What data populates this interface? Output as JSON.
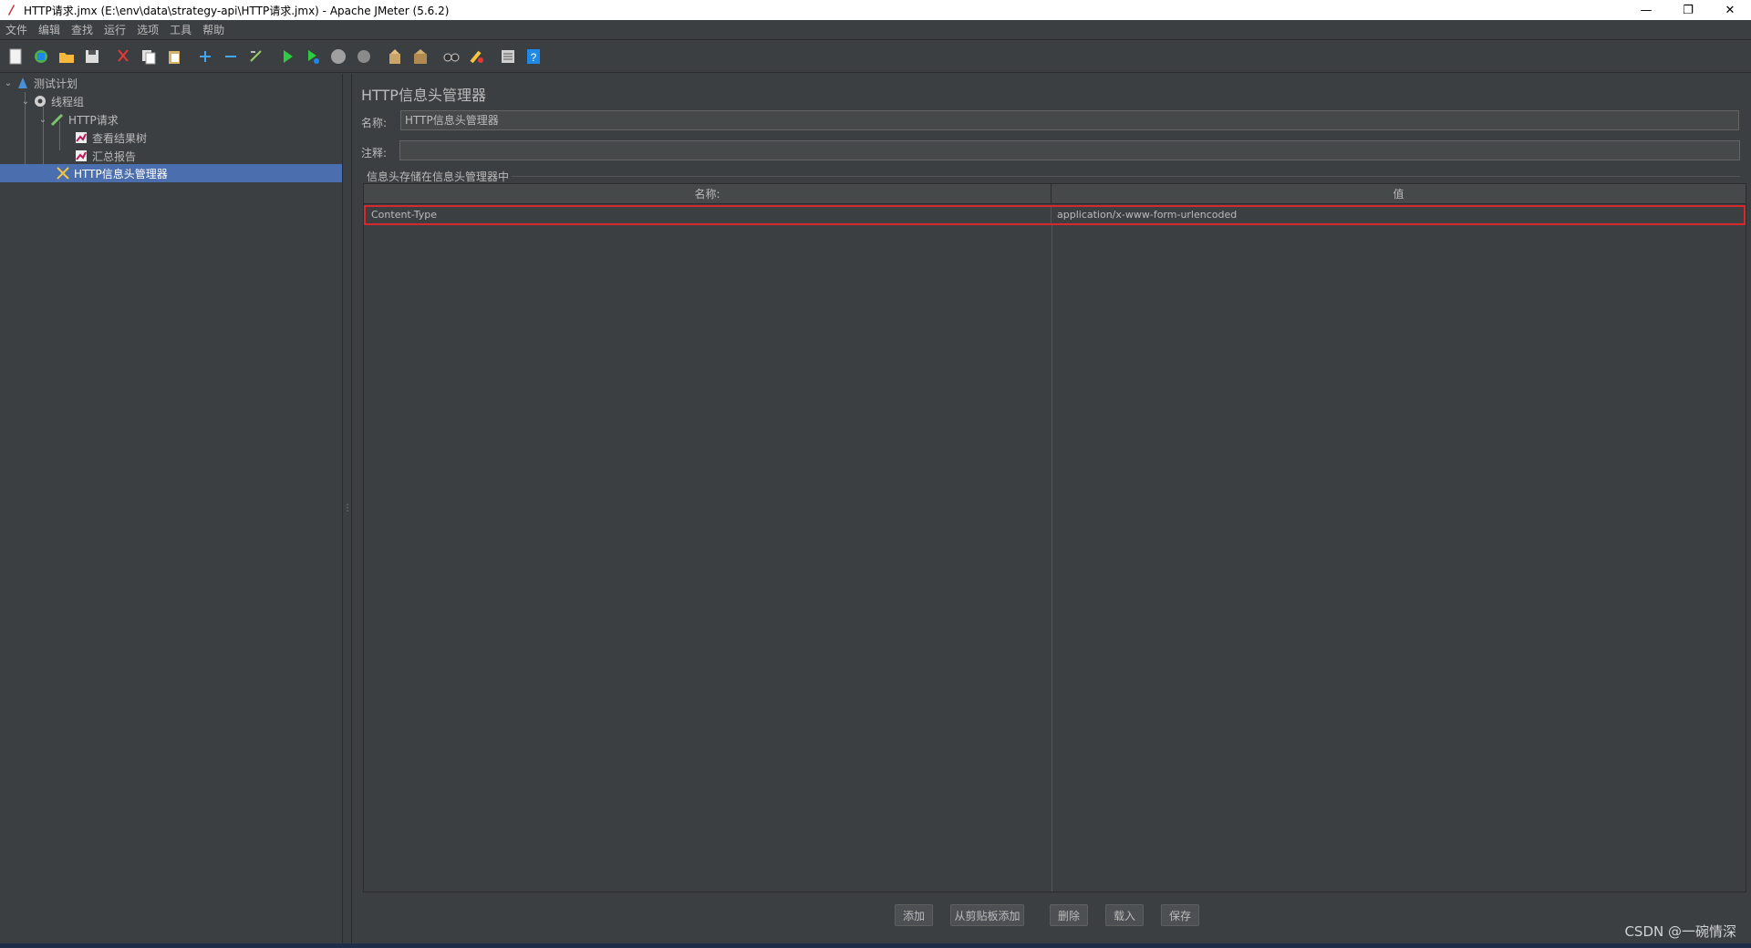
{
  "window": {
    "title": "HTTP请求.jmx (E:\\env\\data\\strategy-api\\HTTP请求.jmx) - Apache JMeter (5.6.2)",
    "minimize": "—",
    "restore": "❐",
    "close": "✕"
  },
  "menu": {
    "items": [
      "文件",
      "编辑",
      "查找",
      "运行",
      "选项",
      "工具",
      "帮助"
    ]
  },
  "toolbar": {
    "buttons": [
      "new-icon",
      "templates-icon",
      "open-icon",
      "save-icon",
      "cut-icon",
      "copy-icon",
      "paste-icon",
      "expand-icon",
      "collapse-icon",
      "toggle-icon",
      "start-icon",
      "start-no-pause-icon",
      "stop-icon",
      "shutdown-icon",
      "clear-icon",
      "clear-all-icon",
      "search-icon",
      "reset-search-icon",
      "function-helper-icon",
      "help-icon"
    ]
  },
  "tree": {
    "items": [
      {
        "label": "测试计划",
        "icon": "test-plan-icon"
      },
      {
        "label": "线程组",
        "icon": "thread-group-icon"
      },
      {
        "label": "HTTP请求",
        "icon": "sampler-icon"
      },
      {
        "label": "查看结果树",
        "icon": "listener-icon"
      },
      {
        "label": "汇总报告",
        "icon": "listener-icon"
      },
      {
        "label": "HTTP信息头管理器",
        "icon": "config-element-icon"
      }
    ]
  },
  "editor": {
    "title": "HTTP信息头管理器",
    "name_label": "名称:",
    "name_value": "HTTP信息头管理器",
    "comment_label": "注释:",
    "comment_value": "",
    "group_title": "信息头存储在信息头管理器中",
    "table": {
      "headers": [
        "名称:",
        "值"
      ],
      "rows": [
        {
          "name": "Content-Type",
          "value": "application/x-www-form-urlencoded"
        }
      ]
    },
    "buttons": {
      "add": "添加",
      "add_from_clipboard": "从剪贴板添加",
      "delete": "删除",
      "load": "载入",
      "save": "保存"
    }
  },
  "watermark": "CSDN @一碗情深",
  "colors": {
    "background": "#3c3f41",
    "selection": "#4b6eaf",
    "highlight_border": "#d9272e"
  }
}
